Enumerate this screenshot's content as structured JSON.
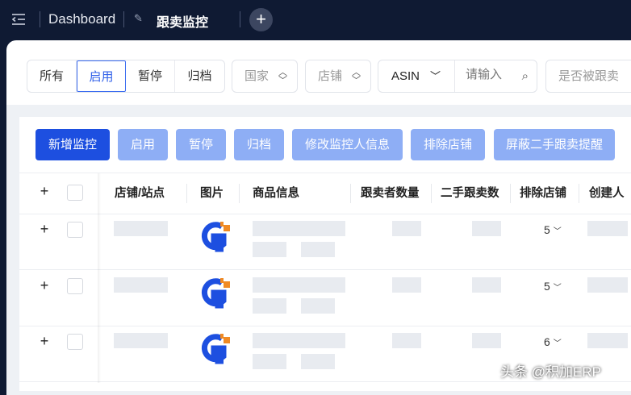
{
  "topbar": {
    "breadcrumb": "Dashboard",
    "active_tab": "跟卖监控",
    "add_tab": "+"
  },
  "filters": {
    "status": [
      "所有",
      "启用",
      "暂停",
      "归档"
    ],
    "status_selected": "启用",
    "country": "国家",
    "store": "店铺",
    "search_type": "ASIN",
    "search_placeholder": "请输入",
    "followed": "是否被跟卖"
  },
  "actions": {
    "add": "新增监控",
    "enable": "启用",
    "pause": "暂停",
    "archive": "归档",
    "edit_monitor": "修改监控人信息",
    "exclude_store": "排除店铺",
    "hide_used": "屏蔽二手跟卖提醒"
  },
  "table": {
    "columns": [
      "店铺/站点",
      "图片",
      "商品信息",
      "跟卖者数量",
      "二手跟卖数",
      "排除店铺",
      "创建人"
    ],
    "rows": [
      {
        "excluded": "5"
      },
      {
        "excluded": "5"
      },
      {
        "excluded": "6"
      }
    ]
  },
  "watermark": "头条 @积加ERP",
  "colors": {
    "primary": "#1d4fe0",
    "nav": "#0f1a33",
    "logo_blue": "#1d4fe0",
    "logo_orange": "#f08a24"
  }
}
